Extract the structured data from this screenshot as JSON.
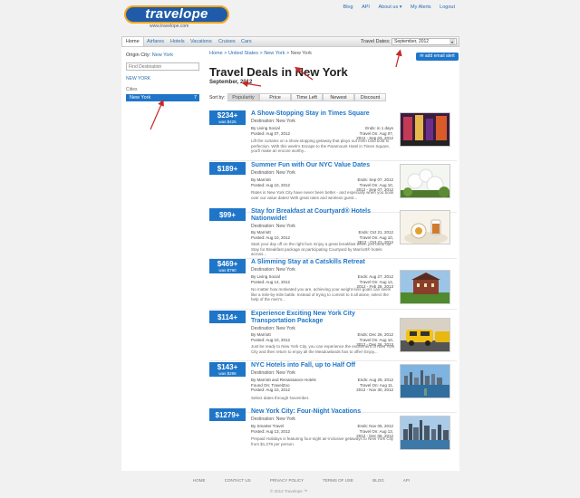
{
  "header": {
    "logo_text": "travelope",
    "logo_sub": "www.travelope.com",
    "links": [
      "Blog",
      "API",
      "About us ▾",
      "My Alerts",
      "Logout"
    ]
  },
  "nav": {
    "tabs": [
      "Home",
      "Airfares",
      "Hotels",
      "Vacations",
      "Cruises",
      "Cars"
    ],
    "travel_dates_label": "Travel Dates:",
    "travel_dates_value": "September, 2012"
  },
  "sidebar": {
    "origin_label": "Origin City:",
    "origin_value": "New York",
    "find_placeholder": "Find Destination",
    "state": "NEW YORK",
    "cities_label": "Cities",
    "city": {
      "name": "New York",
      "count": "7"
    }
  },
  "main": {
    "breadcrumb": [
      "Home",
      "United States",
      "New York",
      "New York"
    ],
    "alert_button": "add email alert",
    "title": "Travel Deals in New York",
    "subtitle": "September, 2012",
    "sort_label": "Sort by:",
    "sort_tabs": [
      "Popularity",
      "Price",
      "Time Left",
      "Newest",
      "Discount"
    ]
  },
  "deals": [
    {
      "price": "$234+",
      "was": "was $425",
      "title": "A Show-Stopping Stay in Times Square",
      "destination": "Destination: New York",
      "by": "By Living Social",
      "posted": "Posted: Aug 07, 2012",
      "ends": "Ends: in 1 days",
      "travel": "Travel On: Aug 07, 2012 - Sep 03, 2012",
      "desc": "Lift the curtains on a show-stopping getaway that plays out even bold bold to perfection. With this week's Escape to the Paramount Hotel in Times Square, you'll make an encore worthy..."
    },
    {
      "price": "$189+",
      "was": "",
      "title": "Summer Fun with Our NYC Value Dates",
      "destination": "Destination: New York",
      "by": "By Marriott",
      "posted": "Posted: Aug 10, 2012",
      "ends": "Ends: Sep 07, 2012",
      "travel": "Travel On: Aug 10, 2012 - Sep 07, 2012",
      "desc": "Rates in New York City have never been better - and especially when you book over our value dates! With great rates and wireless guest..."
    },
    {
      "price": "$99+",
      "was": "",
      "title": "Stay for Breakfast at Courtyard® Hotels Nationwide!",
      "destination": "Destination: New York",
      "by": "By Marriott",
      "posted": "Posted: Aug 10, 2012",
      "ends": "Ends: Oct 21, 2012",
      "travel": "Travel On: Aug 10, 2012 - Oct 21, 2012",
      "desc": "Start your day off on the right foot. Enjoy a great breakfast when you book our Stay for Breakfast package at participating Courtyard by Marriott® hotels across..."
    },
    {
      "price": "$469+",
      "was": "was $790",
      "title": "A Slimming Stay at a Catskills Retreat",
      "destination": "Destination: New York",
      "by": "By Living Social",
      "posted": "Posted: Aug 14, 2012",
      "ends": "Ends: Aug 27, 2012",
      "travel": "Travel On: Aug 14, 2012 - Feb 28, 2013",
      "desc": "No matter how motivated you are, achieving your weight-loss goals can seem like a mile-by-mile battle. Instead of trying to commit to it all alone, select the help of the men's..."
    },
    {
      "price": "$114+",
      "was": "",
      "title": "Experience Exciting New York City Transportation Package",
      "destination": "Destination: New York",
      "by": "By Marriott",
      "posted": "Posted: Aug 10, 2012",
      "ends": "Ends: Dec 26, 2012",
      "travel": "Travel On: Aug 10, 2012 - Dec 26, 2012",
      "desc": "Just be ready to New York City, you can experience the excitement of New York City and then return to enjoy all the Meadowlands has to offer! Enjoy..."
    },
    {
      "price": "$143+",
      "was": "was $286",
      "title": "NYC Hotels into Fall, up to Half Off",
      "destination": "Destination: New York",
      "by": "By Marriott and Renaissance Hotels",
      "posted": "Posted: Aug 10, 2012",
      "found": "Found On: TravelZoo",
      "ends": "Ends: Aug 29, 2012",
      "travel": "Travel On: Aug 11, 2012 - Nov 30, 2012",
      "desc": "Select dates through November."
    },
    {
      "price": "$1279+",
      "was": "",
      "title": "New York City: Four-Night Vacations",
      "destination": "Destination: New York",
      "by": "By Smarter Travel",
      "posted": "Posted: Aug 13, 2012",
      "ends": "Ends: Nov 05, 2012",
      "travel": "Travel On: Aug 13, 2012 - Dec 06, 2012",
      "desc": "Prepaid Holidays is featuring four-night air-inclusive getaways to New York City from $1,279 per person."
    }
  ],
  "footer": {
    "links": [
      "HOME",
      "CONTACT US",
      "PRIVACY POLICY",
      "TERMS OF USE",
      "BLOG",
      "API"
    ],
    "copyright": "© 2012 Travelope ™"
  },
  "colors": {
    "accent": "#1f76c8",
    "brand": "#1f5ba8",
    "annotation": "#c62828"
  }
}
